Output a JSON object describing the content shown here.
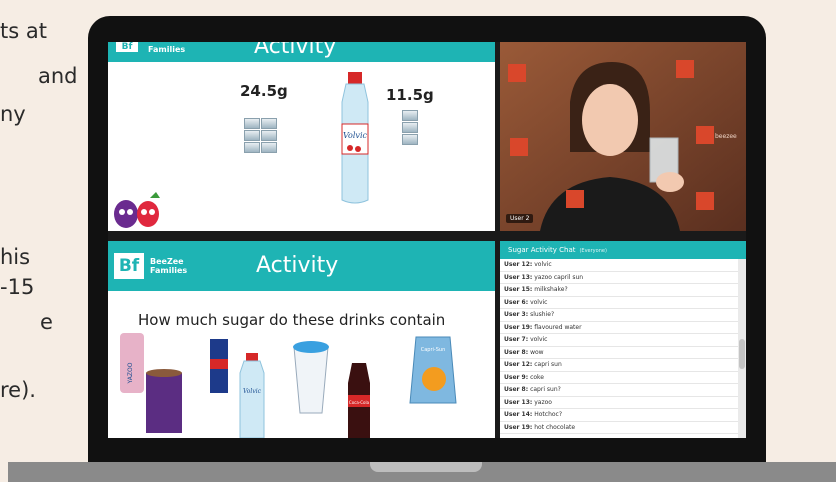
{
  "background_text": {
    "lines": [
      "ts at",
      "and",
      "ny",
      "his",
      " -15",
      "e",
      "re)."
    ]
  },
  "top_slide": {
    "brand_sub": "Families",
    "title": "Activity",
    "left_grams": "24.5g",
    "right_grams": "11.5g",
    "bottle_brand": "Volvic"
  },
  "video": {
    "user_label": "User 2",
    "brand_text": "beezee"
  },
  "bottom_slide": {
    "logo_letter": "Bf",
    "brand_line1": "BeeZee",
    "brand_line2": "Families",
    "title": "Activity",
    "question": "How much sugar do these drinks contain",
    "drinks": [
      "YAZOO",
      "Volvic",
      "Coca-Cola",
      "Capri-Sun"
    ]
  },
  "chat": {
    "title": "Sugar Activity Chat",
    "badge": "(Everyone)",
    "messages": [
      {
        "user": "User 12:",
        "text": "volvic"
      },
      {
        "user": "User 13:",
        "text": "yazoo capril sun"
      },
      {
        "user": "User 15:",
        "text": "milkshake?"
      },
      {
        "user": "User 6:",
        "text": "volvic"
      },
      {
        "user": "User 3:",
        "text": "slushie?"
      },
      {
        "user": "User 19:",
        "text": "flavoured water"
      },
      {
        "user": "User 7:",
        "text": "volvic"
      },
      {
        "user": "User 8:",
        "text": "wow"
      },
      {
        "user": "User 12:",
        "text": "capri sun"
      },
      {
        "user": "User 9:",
        "text": "coke"
      },
      {
        "user": "User 8:",
        "text": "capri sun?"
      },
      {
        "user": "User 13:",
        "text": "yazoo"
      },
      {
        "user": "User 14:",
        "text": "Hotchoc?"
      },
      {
        "user": "User 19:",
        "text": "hot chocolate"
      }
    ]
  },
  "colors": {
    "teal": "#1eb4b4",
    "background": "#f6ede4",
    "laptop": "#111111"
  }
}
